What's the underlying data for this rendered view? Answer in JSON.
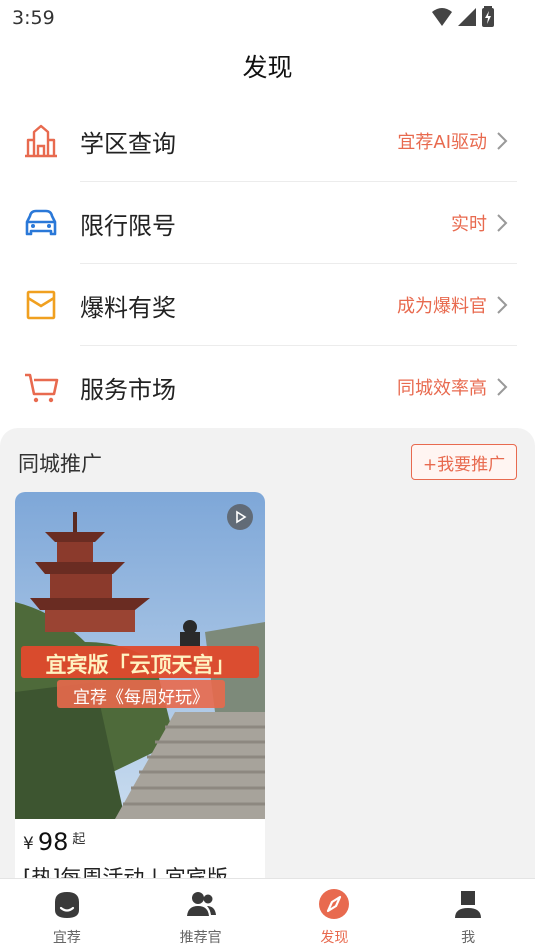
{
  "status": {
    "time": "3:59"
  },
  "page": {
    "title": "发现"
  },
  "menu": [
    {
      "label": "学区查询",
      "sub": "宜荐AI驱动",
      "icon": "school-building-icon"
    },
    {
      "label": "限行限号",
      "sub": "实时",
      "icon": "car-icon"
    },
    {
      "label": "爆料有奖",
      "sub": "成为爆料官",
      "icon": "envelope-icon"
    },
    {
      "label": "服务市场",
      "sub": "同城效率高",
      "icon": "cart-icon"
    }
  ],
  "promo": {
    "title": "同城推广",
    "button": "+我要推广",
    "card": {
      "banner_line1": "宜宾版「云顶天宫」",
      "banner_line2": "宜荐《每周好玩》",
      "currency": "¥",
      "price": "98",
      "price_suffix": "起",
      "title": "[热]每周活动 | 宜宾版"
    }
  },
  "tabs": [
    {
      "label": "宜荐",
      "icon": "home-face-icon",
      "active": false
    },
    {
      "label": "推荐官",
      "icon": "people-icon",
      "active": false
    },
    {
      "label": "发现",
      "icon": "compass-icon",
      "active": true
    },
    {
      "label": "我",
      "icon": "person-icon",
      "active": false
    }
  ],
  "colors": {
    "accent": "#e86a4f",
    "car_blue": "#2a78d8",
    "envelope_orange": "#f0a020"
  }
}
